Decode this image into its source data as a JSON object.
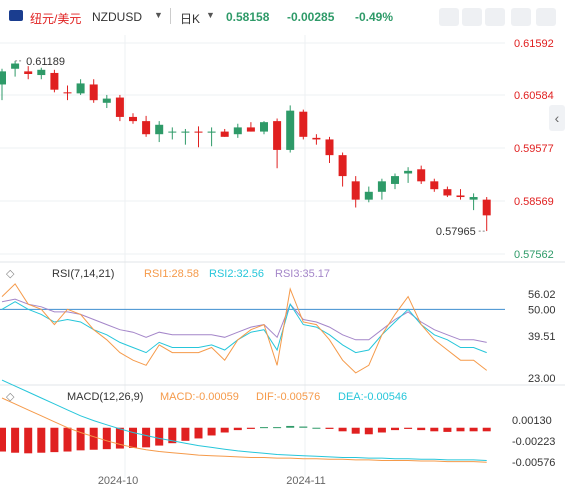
{
  "header": {
    "pair_cn": "纽元/美元",
    "symbol": "NZDUSD",
    "interval": "日K",
    "price": "0.58158",
    "change": "-0.00285",
    "change_pct": "-0.49%"
  },
  "colors": {
    "up": "#2e9a68",
    "down": "#e02020",
    "price_axis_text": "#e02020",
    "green_axis_text": "#2e9a68",
    "rsi1": "#f59a4a",
    "rsi2": "#26c6da",
    "rsi3": "#a486c9",
    "macd_line": "#f59a4a",
    "dea_line": "#26c6da",
    "rsi_50_line": "#3e8ed0"
  },
  "toolbar_icons": [
    "chart-type-icon",
    "drawing-icon",
    "settings-icon",
    "fullscreen-icon",
    "close-icon"
  ],
  "rsi_panel": {
    "title": "RSI(7,14,21)",
    "rsi1_label": "RSI1:28.58",
    "rsi2_label": "RSI2:32.56",
    "rsi3_label": "RSI3:35.17",
    "axis_ticks": [
      "56.02",
      "50.00",
      "39.51",
      "23.00"
    ]
  },
  "macd_panel": {
    "title": "MACD(12,26,9)",
    "macd_label": "MACD:-0.00059",
    "dif_label": "DIF:-0.00576",
    "dea_label": "DEA:-0.00546",
    "axis_ticks": [
      "0.00130",
      "-0.00223",
      "-0.00576"
    ]
  },
  "chart_data": {
    "type": "candlestick",
    "price_axis_ticks": [
      "0.61592",
      "0.60584",
      "0.59577",
      "0.58569",
      "0.57562"
    ],
    "x_labels": [
      "2024-10",
      "2024-11"
    ],
    "high_annotation": "0.61189",
    "low_annotation": "0.57965",
    "candles": [
      {
        "o": 0.608,
        "h": 0.611,
        "l": 0.605,
        "c": 0.6105
      },
      {
        "o": 0.611,
        "h": 0.6125,
        "l": 0.6095,
        "c": 0.612
      },
      {
        "o": 0.6105,
        "h": 0.6115,
        "l": 0.609,
        "c": 0.61
      },
      {
        "o": 0.6098,
        "h": 0.6112,
        "l": 0.609,
        "c": 0.6108
      },
      {
        "o": 0.6102,
        "h": 0.6108,
        "l": 0.6065,
        "c": 0.607
      },
      {
        "o": 0.6065,
        "h": 0.6078,
        "l": 0.605,
        "c": 0.6063
      },
      {
        "o": 0.6063,
        "h": 0.609,
        "l": 0.606,
        "c": 0.6082
      },
      {
        "o": 0.608,
        "h": 0.609,
        "l": 0.6045,
        "c": 0.605
      },
      {
        "o": 0.6045,
        "h": 0.606,
        "l": 0.6035,
        "c": 0.6053
      },
      {
        "o": 0.6055,
        "h": 0.606,
        "l": 0.601,
        "c": 0.6018
      },
      {
        "o": 0.6018,
        "h": 0.6025,
        "l": 0.6005,
        "c": 0.601
      },
      {
        "o": 0.601,
        "h": 0.602,
        "l": 0.598,
        "c": 0.5985
      },
      {
        "o": 0.5985,
        "h": 0.601,
        "l": 0.597,
        "c": 0.6003
      },
      {
        "o": 0.599,
        "h": 0.5998,
        "l": 0.5975,
        "c": 0.599
      },
      {
        "o": 0.5988,
        "h": 0.5995,
        "l": 0.5965,
        "c": 0.599
      },
      {
        "o": 0.599,
        "h": 0.6,
        "l": 0.596,
        "c": 0.5988
      },
      {
        "o": 0.5988,
        "h": 0.5998,
        "l": 0.5962,
        "c": 0.599
      },
      {
        "o": 0.599,
        "h": 0.5995,
        "l": 0.598,
        "c": 0.598
      },
      {
        "o": 0.5985,
        "h": 0.6005,
        "l": 0.5978,
        "c": 0.5998
      },
      {
        "o": 0.5998,
        "h": 0.6008,
        "l": 0.599,
        "c": 0.599
      },
      {
        "o": 0.599,
        "h": 0.601,
        "l": 0.5985,
        "c": 0.6008
      },
      {
        "o": 0.601,
        "h": 0.6015,
        "l": 0.592,
        "c": 0.5955
      },
      {
        "o": 0.5955,
        "h": 0.604,
        "l": 0.595,
        "c": 0.603
      },
      {
        "o": 0.6028,
        "h": 0.6032,
        "l": 0.5975,
        "c": 0.598
      },
      {
        "o": 0.5978,
        "h": 0.5985,
        "l": 0.5965,
        "c": 0.5975
      },
      {
        "o": 0.5975,
        "h": 0.598,
        "l": 0.593,
        "c": 0.5945
      },
      {
        "o": 0.5945,
        "h": 0.595,
        "l": 0.5885,
        "c": 0.5905
      },
      {
        "o": 0.5895,
        "h": 0.5905,
        "l": 0.5845,
        "c": 0.586
      },
      {
        "o": 0.586,
        "h": 0.5885,
        "l": 0.5855,
        "c": 0.5875
      },
      {
        "o": 0.5875,
        "h": 0.59,
        "l": 0.586,
        "c": 0.5895
      },
      {
        "o": 0.589,
        "h": 0.591,
        "l": 0.588,
        "c": 0.5905
      },
      {
        "o": 0.591,
        "h": 0.5922,
        "l": 0.5892,
        "c": 0.5915
      },
      {
        "o": 0.5918,
        "h": 0.5925,
        "l": 0.589,
        "c": 0.5895
      },
      {
        "o": 0.5895,
        "h": 0.59,
        "l": 0.5875,
        "c": 0.588
      },
      {
        "o": 0.588,
        "h": 0.5885,
        "l": 0.5865,
        "c": 0.5868
      },
      {
        "o": 0.5868,
        "h": 0.588,
        "l": 0.586,
        "c": 0.5865
      },
      {
        "o": 0.586,
        "h": 0.5872,
        "l": 0.584,
        "c": 0.5865
      },
      {
        "o": 0.586,
        "h": 0.5865,
        "l": 0.58,
        "c": 0.583
      }
    ],
    "rsi1": [
      55,
      60,
      52,
      50,
      44,
      50,
      48,
      42,
      38,
      33,
      30,
      28,
      36,
      33,
      33,
      33,
      35,
      30,
      38,
      42,
      44,
      28,
      58,
      45,
      44,
      38,
      30,
      25,
      28,
      40,
      48,
      55,
      44,
      38,
      34,
      30,
      30,
      26
    ],
    "rsi2": [
      50,
      53,
      50,
      48,
      45,
      46,
      45,
      42,
      40,
      37,
      35,
      33,
      37,
      35,
      35,
      35,
      36,
      34,
      38,
      41,
      42,
      34,
      52,
      44,
      43,
      40,
      36,
      33,
      34,
      40,
      45,
      50,
      44,
      40,
      38,
      35,
      35,
      33
    ],
    "rsi3": [
      53,
      54,
      52,
      51,
      49,
      49,
      48,
      46,
      44,
      42,
      41,
      39,
      41,
      40,
      40,
      40,
      40,
      39,
      41,
      43,
      44,
      39,
      52,
      46,
      45,
      43,
      40,
      38,
      38,
      42,
      46,
      49,
      45,
      42,
      40,
      38,
      38,
      37
    ],
    "macd_hist": [
      -0.004,
      -0.0042,
      -0.0043,
      -0.0042,
      -0.0041,
      -0.004,
      -0.0038,
      -0.0037,
      -0.0036,
      -0.0035,
      -0.0034,
      -0.0033,
      -0.003,
      -0.0026,
      -0.0022,
      -0.0018,
      -0.0013,
      -0.0008,
      -0.0004,
      -0.0002,
      0.0001,
      0.0001,
      0.0003,
      0.0002,
      0.0,
      -0.0002,
      -0.0006,
      -0.001,
      -0.0011,
      -0.0008,
      -0.0004,
      -0.0002,
      -0.0004,
      -0.0006,
      -0.0007,
      -0.0006,
      -0.0006,
      -0.0006
    ],
    "dif": [
      0.005,
      0.004,
      0.003,
      0.002,
      0.001,
      0.0,
      -0.0008,
      -0.0015,
      -0.0022,
      -0.0028,
      -0.0033,
      -0.0037,
      -0.004,
      -0.0042,
      -0.0044,
      -0.0046,
      -0.0047,
      -0.0048,
      -0.0049,
      -0.005,
      -0.005,
      -0.0051,
      -0.0051,
      -0.0052,
      -0.0052,
      -0.0053,
      -0.0053,
      -0.0054,
      -0.0054,
      -0.0055,
      -0.0055,
      -0.0055,
      -0.0056,
      -0.0056,
      -0.0057,
      -0.0057,
      -0.0057,
      -0.0058
    ],
    "dea": [
      0.008,
      0.007,
      0.006,
      0.005,
      0.004,
      0.003,
      0.002,
      0.0012,
      0.0005,
      -0.0002,
      -0.0008,
      -0.0013,
      -0.0018,
      -0.0022,
      -0.0026,
      -0.003,
      -0.0033,
      -0.0036,
      -0.0039,
      -0.0041,
      -0.0043,
      -0.0045,
      -0.0046,
      -0.0047,
      -0.0048,
      -0.0049,
      -0.005,
      -0.005,
      -0.0051,
      -0.0051,
      -0.0052,
      -0.0052,
      -0.0053,
      -0.0053,
      -0.0054,
      -0.0054,
      -0.0054,
      -0.0055
    ]
  }
}
